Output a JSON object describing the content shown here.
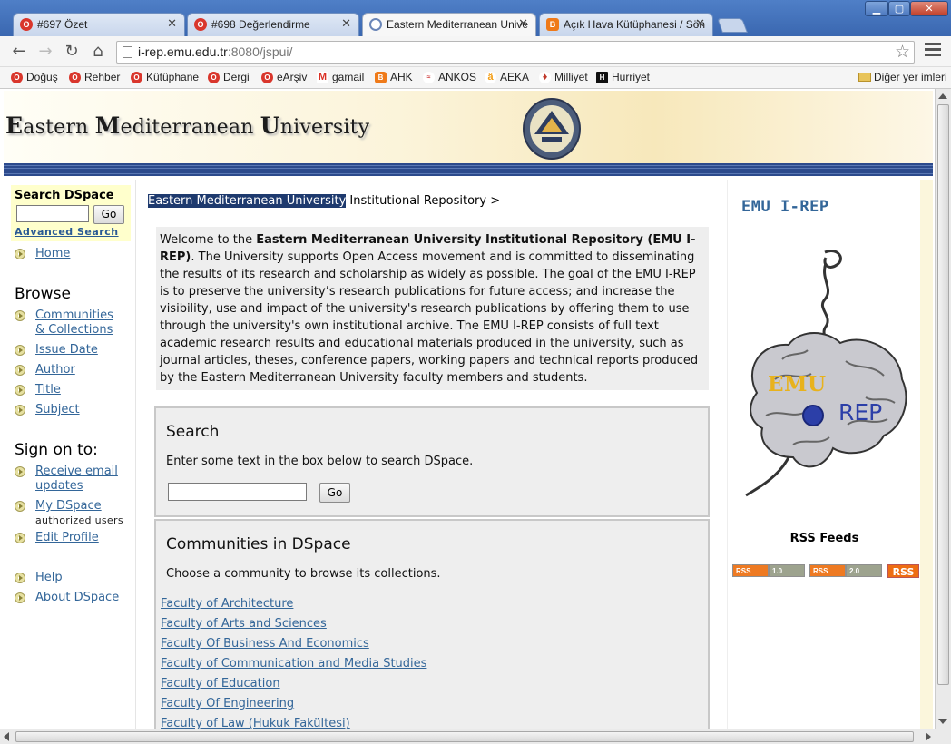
{
  "browser": {
    "tabs": [
      {
        "title": "#697 Özet",
        "favicon": "opera-icon",
        "color": "#d9362c"
      },
      {
        "title": "#698 Değerlendirme",
        "favicon": "opera-icon",
        "color": "#d9362c"
      },
      {
        "title": "Eastern Mediterranean Unive",
        "favicon": "emu-icon",
        "color": "#6a86b8"
      },
      {
        "title": "Açık Hava Kütüphanesi / Sön",
        "favicon": "blogger-icon",
        "color": "#ef7a19"
      }
    ],
    "active_tab": 2,
    "url_host": "i-rep.emu.edu.tr",
    "url_rest": ":8080/jspui/",
    "bookmarks": [
      {
        "label": "Doğuş",
        "icon": "opera-icon",
        "color": "#d9362c"
      },
      {
        "label": "Rehber",
        "icon": "opera-icon",
        "color": "#d9362c"
      },
      {
        "label": "Kütüphane",
        "icon": "opera-icon",
        "color": "#d9362c"
      },
      {
        "label": "Dergi",
        "icon": "opera-icon",
        "color": "#d9362c"
      },
      {
        "label": "eArşiv",
        "icon": "opera-icon",
        "color": "#d9362c"
      },
      {
        "label": "gamail",
        "icon": "gmail-icon",
        "color": "#d93025"
      },
      {
        "label": "AHK",
        "icon": "blogger-icon",
        "color": "#ef7a19"
      },
      {
        "label": "ANKOS",
        "icon": "ankos-icon",
        "color": "#c33"
      },
      {
        "label": "AEKA",
        "icon": "aeka-icon",
        "color": "#f39c12"
      },
      {
        "label": "Milliyet",
        "icon": "milliyet-icon",
        "color": "#c0392b"
      },
      {
        "label": "Hurriyet",
        "icon": "hurriyet-icon",
        "color": "#111"
      }
    ],
    "other_bookmarks": "Diğer yer imleri"
  },
  "header": {
    "site_title_parts": [
      "E",
      "astern ",
      "M",
      "editerranean ",
      "U",
      "niversity"
    ]
  },
  "leftnav": {
    "search_title": "Search DSpace",
    "go_label": "Go",
    "advanced_search": "Advanced Search",
    "home": "Home",
    "browse_heading": "Browse",
    "browse_items": [
      "Communities",
      "& Collections",
      "Issue Date",
      "Author",
      "Title",
      "Subject"
    ],
    "signon_heading": "Sign on to:",
    "receive_email": [
      "Receive email",
      "updates"
    ],
    "my_dspace": "My DSpace",
    "my_dspace_sub": "authorized users",
    "edit_profile": "Edit Profile",
    "help": "Help",
    "about": "About DSpace"
  },
  "main": {
    "breadcrumb_selected": "Eastern Mediterranean University",
    "breadcrumb_rest": " Institutional Repository >",
    "welcome_pre": "Welcome to the ",
    "welcome_bold": "Eastern Mediterranean University Institutional Repository (EMU I-REP)",
    "welcome_post": ". The University supports Open Access movement and is committed to disseminating the results of its research and scholarship as widely as possible. The goal of the EMU I-REP is to preserve the university’s research publications for future access; and increase the visibility, use and impact of the university's research publications by offering them to use through the university's own institutional archive. The EMU I-REP consists of full text academic research results and educational materials produced in the university, such as journal articles, theses, conference papers, working papers and technical reports produced by the Eastern Mediterranean University faculty members and students.",
    "search_title": "Search",
    "search_text": "Enter some text in the box below to search DSpace.",
    "go_label": "Go",
    "communities_title": "Communities in DSpace",
    "communities_text": "Choose a community to browse its collections.",
    "communities": [
      "Faculty of Architecture",
      "Faculty of Arts and Sciences",
      "Faculty Of Business And Economics",
      "Faculty of Communication and Media Studies",
      "Faculty of Education",
      "Faculty Of Engineering",
      "Faculty of Law (Hukuk Fakültesi)"
    ]
  },
  "rightbar": {
    "title": "EMU I-REP",
    "logo_emu": "EMU",
    "logo_rep": "REP",
    "rss_title": "RSS Feeds",
    "rss_badges": [
      {
        "left": "RSS",
        "right": "1.0"
      },
      {
        "left": "RSS",
        "right": "2.0"
      }
    ],
    "rss_plain": "RSS"
  }
}
